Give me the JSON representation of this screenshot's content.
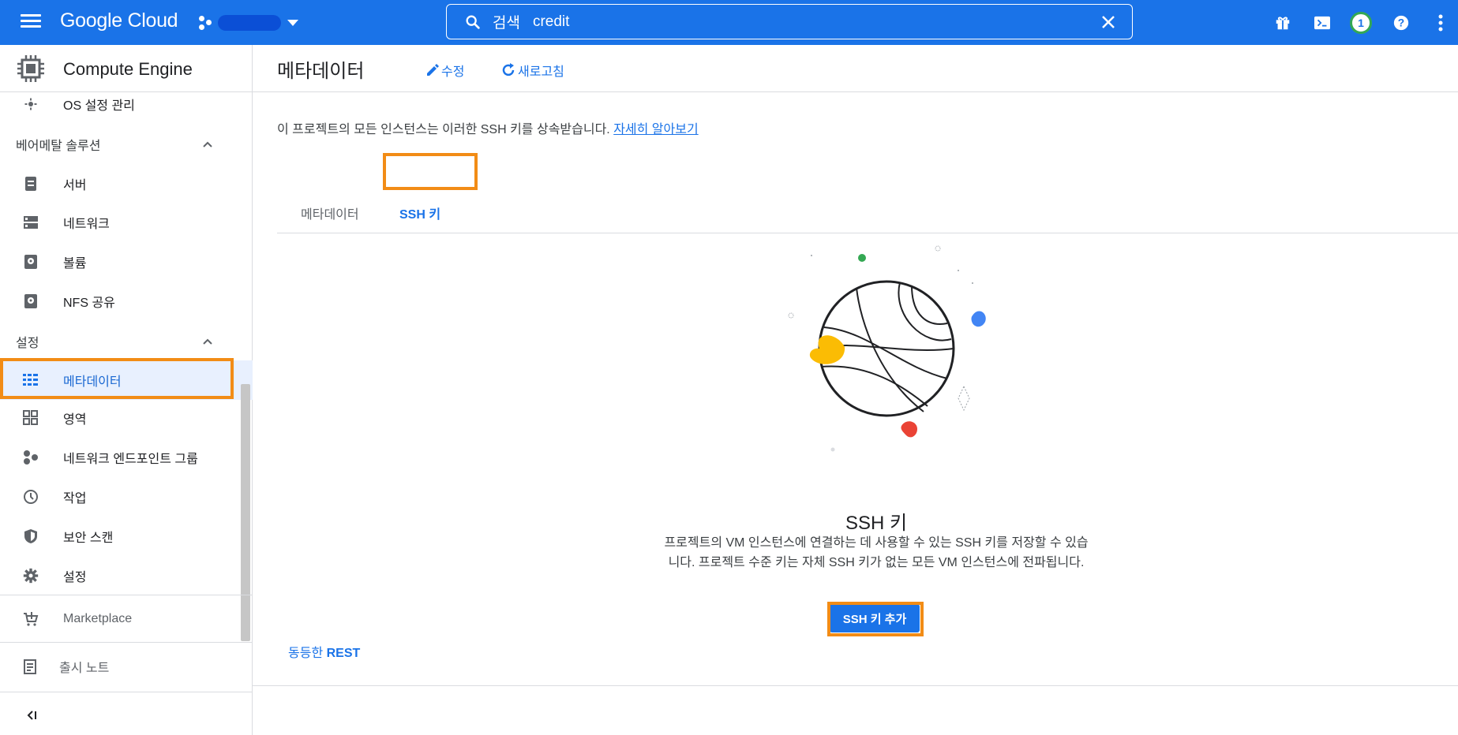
{
  "topbar": {
    "logo": "Google Cloud",
    "search": {
      "label": "검색",
      "value": "credit"
    },
    "notification_count": "1"
  },
  "sidebar": {
    "product": "Compute Engine",
    "items": [
      {
        "label": "OS 설정 관리",
        "icon": "gear-small-icon"
      },
      {
        "section": "베어메탈 솔루션"
      },
      {
        "label": "서버",
        "icon": "server-icon"
      },
      {
        "label": "네트워크",
        "icon": "network-icon"
      },
      {
        "label": "볼륨",
        "icon": "volume-icon"
      },
      {
        "label": "NFS 공유",
        "icon": "nfs-icon"
      },
      {
        "section": "설정"
      },
      {
        "label": "메타데이터",
        "icon": "metadata-icon",
        "selected": true
      },
      {
        "label": "영역",
        "icon": "zone-icon"
      },
      {
        "label": "네트워크 엔드포인트 그룹",
        "icon": "endpoint-group-icon"
      },
      {
        "label": "작업",
        "icon": "clock-icon"
      },
      {
        "label": "보안 스캔",
        "icon": "shield-icon"
      },
      {
        "label": "설정",
        "icon": "settings-icon"
      }
    ],
    "marketplace": "Marketplace",
    "release_notes": "출시 노트",
    "collapse": "<|"
  },
  "main": {
    "title": "메타데이터",
    "edit": "수정",
    "refresh": "새로고침",
    "info": "이 프로젝트의 모든 인스턴스는 이러한 SSH 키를 상속받습니다.",
    "learn_more": "자세히 알아보기",
    "tabs": [
      {
        "label": "메타데이터",
        "active": false
      },
      {
        "label": "SSH 키",
        "active": true
      }
    ],
    "empty_title": "SSH 키",
    "empty_desc_line1": "프로젝트의 VM 인스턴스에 연결하는 데 사용할 수 있는 SSH 키를 저장할 수 있습",
    "empty_desc_line2": "니다. 프로젝트 수준 키는 자체 SSH 키가 없는 모든 VM 인스턴스에 전파됩니다.",
    "add_button": "SSH 키 추가",
    "rest_prefix": "동등한",
    "rest_bold": "REST"
  },
  "colors": {
    "brand": "#1a73e8",
    "highlight": "#f28c16",
    "selected_bg": "#e8f0fe"
  }
}
